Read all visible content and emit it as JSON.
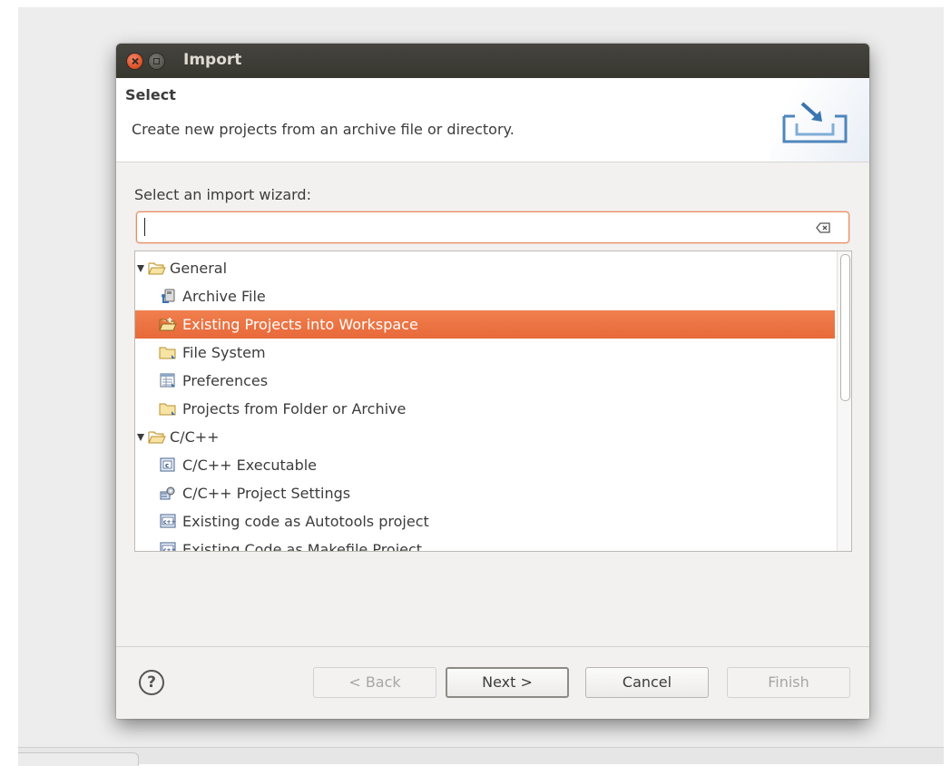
{
  "window": {
    "title": "Import"
  },
  "header": {
    "title": "Select",
    "description": "Create new projects from an archive file or directory."
  },
  "wizard": {
    "label": "Select an import wizard:",
    "filter_value": ""
  },
  "tree": {
    "items": [
      {
        "label": "General",
        "level": 0,
        "expanded": true,
        "icon": "folder-open-icon"
      },
      {
        "label": "Archive File",
        "level": 1,
        "icon": "archive-file-icon"
      },
      {
        "label": "Existing Projects into Workspace",
        "level": 1,
        "icon": "project-folder-icon",
        "selected": true
      },
      {
        "label": "File System",
        "level": 1,
        "icon": "folder-icon"
      },
      {
        "label": "Preferences",
        "level": 1,
        "icon": "preferences-icon"
      },
      {
        "label": "Projects from Folder or Archive",
        "level": 1,
        "icon": "folder-icon"
      },
      {
        "label": "C/C++",
        "level": 0,
        "expanded": true,
        "icon": "folder-open-icon"
      },
      {
        "label": "C/C++ Executable",
        "level": 1,
        "icon": "c-executable-icon"
      },
      {
        "label": "C/C++ Project Settings",
        "level": 1,
        "icon": "settings-icon"
      },
      {
        "label": "Existing code as Autotools project",
        "level": 1,
        "icon": "cpp-file-icon"
      },
      {
        "label": "Existing Code as Makefile Project",
        "level": 1,
        "icon": "cpp-file-icon"
      }
    ]
  },
  "buttons": {
    "help": "?",
    "back": "< Back",
    "next": "Next >",
    "cancel": "Cancel",
    "finish": "Finish"
  },
  "colors": {
    "selection": "#f07f4d",
    "titlebar": "#3e3d37",
    "close": "#e0542b",
    "focus_border": "#e98e62"
  }
}
